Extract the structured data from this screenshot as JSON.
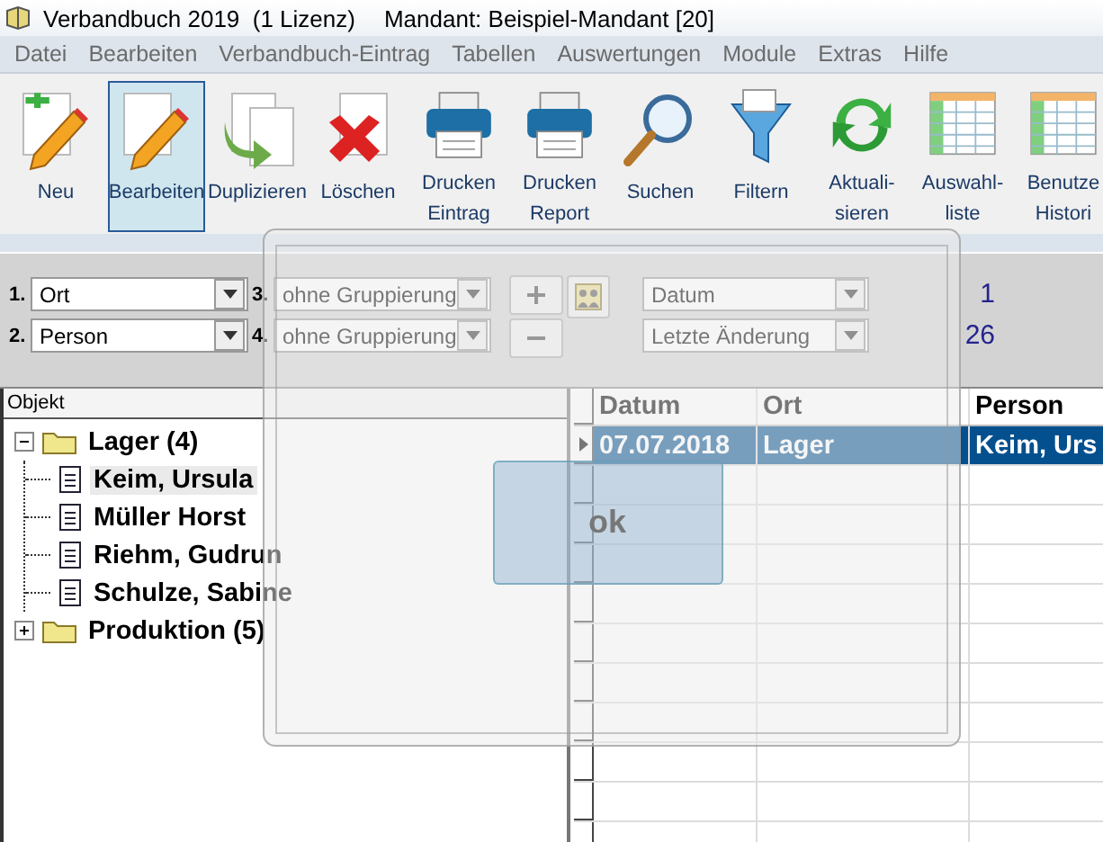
{
  "window": {
    "title": "Verbandbuch 2019  (1 Lizenz)",
    "mandant": "Mandant: Beispiel-Mandant [20]"
  },
  "menu": [
    "Datei",
    "Bearbeiten",
    "Verbandbuch-Eintrag",
    "Tabellen",
    "Auswertungen",
    "Module",
    "Extras",
    "Hilfe"
  ],
  "toolbar": [
    {
      "lines": [
        "Neu"
      ],
      "selected": false
    },
    {
      "lines": [
        "Bearbeiten"
      ],
      "selected": true
    },
    {
      "lines": [
        "Duplizieren"
      ],
      "selected": false
    },
    {
      "lines": [
        "Löschen"
      ],
      "selected": false
    },
    {
      "lines": [
        "Drucken",
        "Eintrag"
      ],
      "selected": false
    },
    {
      "lines": [
        "Drucken",
        "Report"
      ],
      "selected": false
    },
    {
      "lines": [
        "Suchen"
      ],
      "selected": false
    },
    {
      "lines": [
        "Filtern"
      ],
      "selected": false
    },
    {
      "lines": [
        "Aktuali-",
        "sieren"
      ],
      "selected": false
    },
    {
      "lines": [
        "Auswahl-",
        "liste"
      ],
      "selected": false
    },
    {
      "lines": [
        "Benutze",
        "Histori"
      ],
      "selected": false
    }
  ],
  "grouping": {
    "levels": [
      {
        "number": "1.",
        "value": "Ort"
      },
      {
        "number": "2.",
        "value": "Person"
      },
      {
        "number": "3.",
        "value": "ohne Gruppierung"
      },
      {
        "number": "4.",
        "value": "ohne Gruppierung"
      }
    ],
    "sort": [
      {
        "value": "Datum",
        "count": "1"
      },
      {
        "value": "Letzte Änderung",
        "count": "26"
      }
    ]
  },
  "tree": {
    "header": "Objekt",
    "items": [
      {
        "label": "Lager",
        "count": "(4)",
        "expanded": true,
        "children": [
          {
            "label": "Keim, Ursula",
            "selected": true
          },
          {
            "label": "Müller Horst",
            "selected": false
          },
          {
            "label": "Riehm, Gudrun",
            "selected": false
          },
          {
            "label": "Schulze, Sabine",
            "selected": false
          }
        ]
      },
      {
        "label": "Produktion",
        "count": "(5)",
        "expanded": false
      }
    ]
  },
  "grid": {
    "columns": [
      "Datum",
      "Ort",
      "Person"
    ],
    "rows": [
      {
        "cells": [
          "07.07.2018",
          "Lager",
          "Keim, Urs"
        ],
        "selected": true
      }
    ]
  },
  "dialog": {
    "button": "ok"
  }
}
